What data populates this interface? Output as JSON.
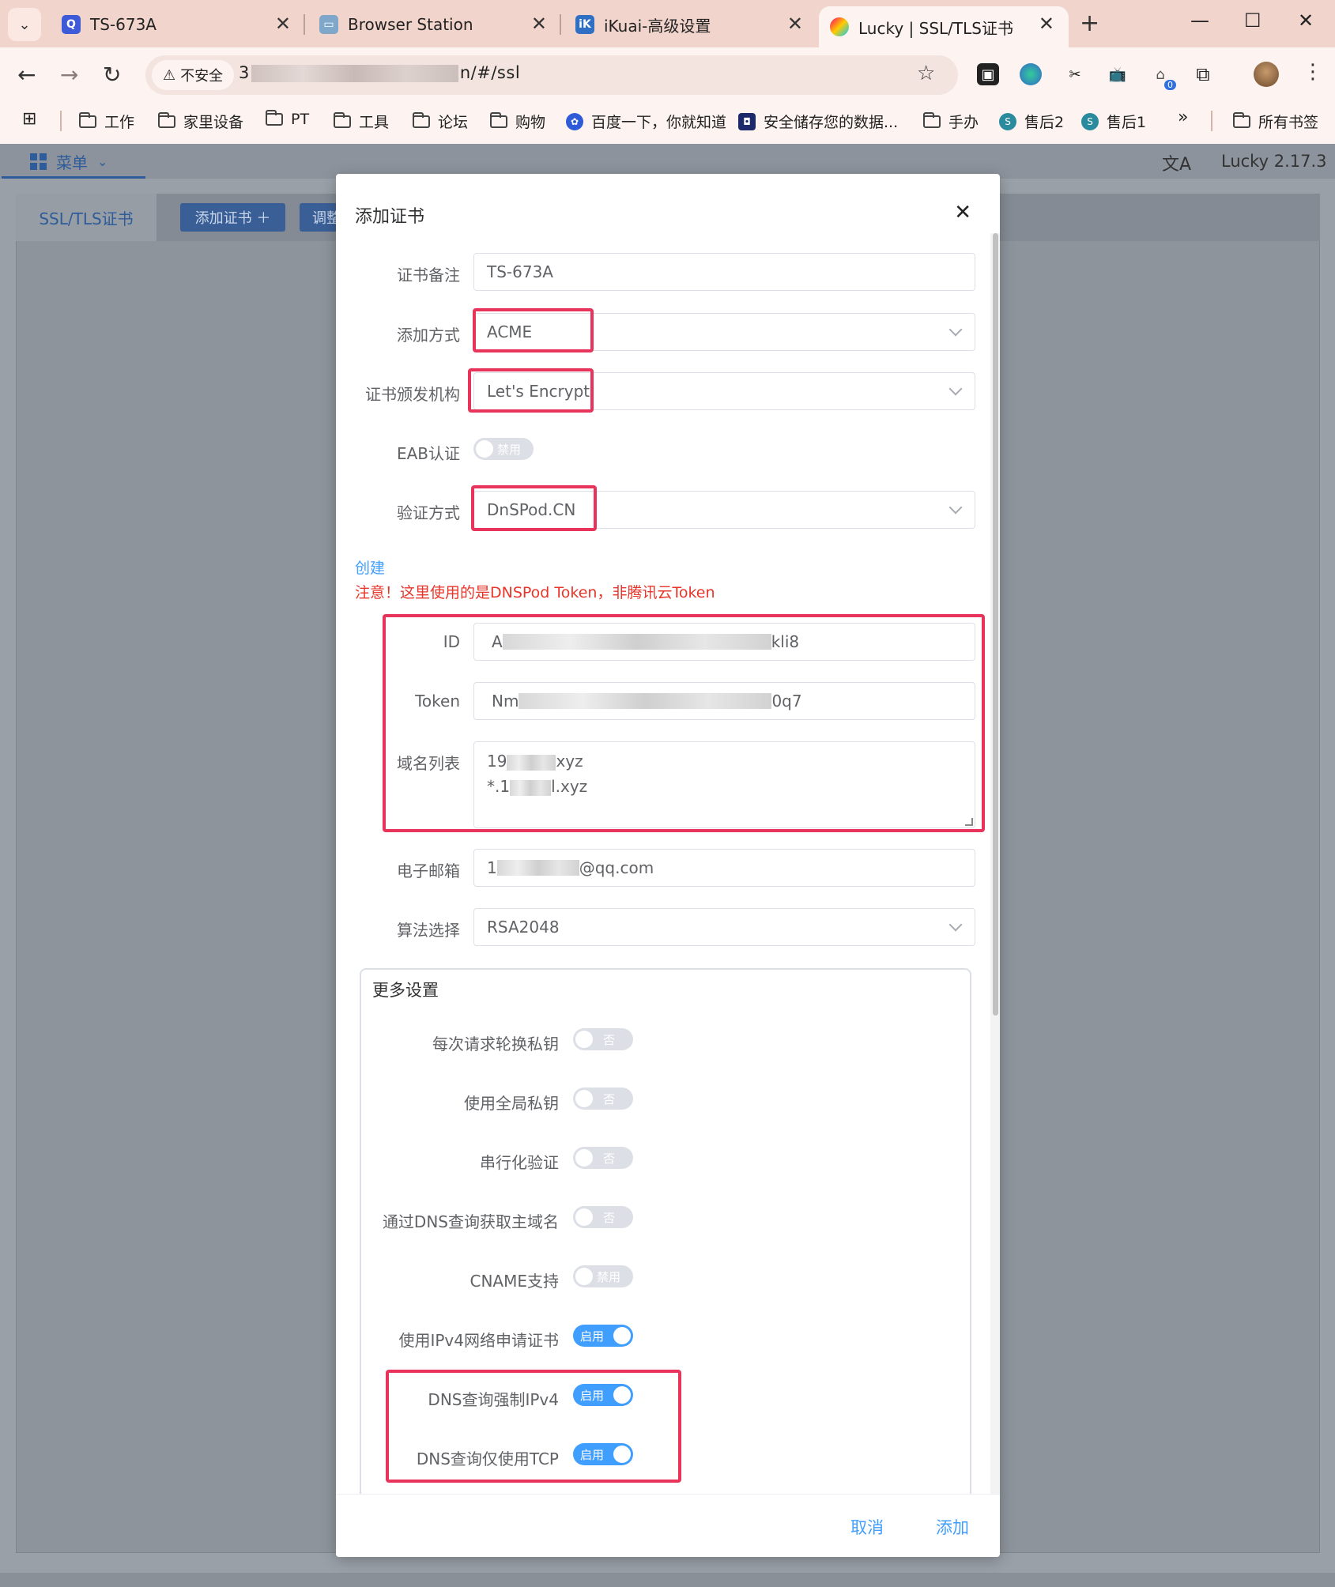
{
  "browser": {
    "tabs": [
      {
        "title": "TS-673A",
        "active": false
      },
      {
        "title": "Browser Station",
        "active": false
      },
      {
        "title": "iKuai-高级设置",
        "active": false
      },
      {
        "title": "Lucky | SSL/TLS证书",
        "active": true
      }
    ],
    "security_label": "不安全",
    "url_prefix": "3",
    "url_suffix": "n/#/ssl",
    "extension_badge": "0"
  },
  "bookmarks": [
    {
      "label": "工作",
      "type": "folder"
    },
    {
      "label": "家里设备",
      "type": "folder"
    },
    {
      "label": "PT",
      "type": "folder"
    },
    {
      "label": "工具",
      "type": "folder"
    },
    {
      "label": "论坛",
      "type": "folder"
    },
    {
      "label": "购物",
      "type": "folder"
    },
    {
      "label": "百度一下，你就知道",
      "type": "site"
    },
    {
      "label": "安全储存您的数据...",
      "type": "site"
    },
    {
      "label": "手办",
      "type": "folder"
    },
    {
      "label": "售后2",
      "type": "site"
    },
    {
      "label": "售后1",
      "type": "site"
    },
    {
      "label": "所有书签",
      "type": "folder"
    }
  ],
  "app": {
    "menu_label": "菜单",
    "version": "Lucky 2.17.3",
    "sub_tab": "SSL/TLS证书",
    "add_cert_button": "添加证书 ＋",
    "adjust_button": "调整"
  },
  "dialog": {
    "title": "添加证书",
    "fields": {
      "remark": {
        "label": "证书备注",
        "value": "TS-673A"
      },
      "add_method": {
        "label": "添加方式",
        "value": "ACME"
      },
      "ca": {
        "label": "证书颁发机构",
        "value": "Let's Encrypt"
      },
      "eab": {
        "label": "EAB认证",
        "switch_text": "禁用",
        "enabled": false
      },
      "verify_method": {
        "label": "验证方式",
        "value": "DnSPod.CN"
      },
      "id": {
        "label": "ID",
        "value_start": "A",
        "value_end": "kli8"
      },
      "token": {
        "label": "Token",
        "value_start": "Nm",
        "value_end": "0q7"
      },
      "domains": {
        "label": "域名列表",
        "line1_start": "19",
        "line1_end": "xyz",
        "line2_start": "*.1",
        "line2_end": "l.xyz"
      },
      "email": {
        "label": "电子邮箱",
        "value_start": "1",
        "value_end": "@qq.com"
      },
      "algorithm": {
        "label": "算法选择",
        "value": "RSA2048"
      }
    },
    "create_link": "创建",
    "warning": "注意！这里使用的是DNSPod Token，非腾讯云Token",
    "more_settings": {
      "title": "更多设置",
      "items": [
        {
          "label": "每次请求轮换私钥",
          "switch_text": "否",
          "enabled": false
        },
        {
          "label": "使用全局私钥",
          "switch_text": "否",
          "enabled": false
        },
        {
          "label": "串行化验证",
          "switch_text": "否",
          "enabled": false
        },
        {
          "label": "通过DNS查询获取主域名",
          "switch_text": "否",
          "enabled": false
        },
        {
          "label": "CNAME支持",
          "switch_text": "禁用",
          "enabled": false
        },
        {
          "label": "使用IPv4网络申请证书",
          "switch_text": "启用",
          "enabled": true
        },
        {
          "label": "DNS查询强制IPv4",
          "switch_text": "启用",
          "enabled": true
        },
        {
          "label": "DNS查询仅使用TCP",
          "switch_text": "启用",
          "enabled": true
        }
      ]
    },
    "cancel_button": "取消",
    "add_button": "添加"
  },
  "colors": {
    "primary": "#409eff",
    "highlight": "#e8335a",
    "warning": "#e8352a",
    "chrome_bg": "#f1d5cc"
  }
}
